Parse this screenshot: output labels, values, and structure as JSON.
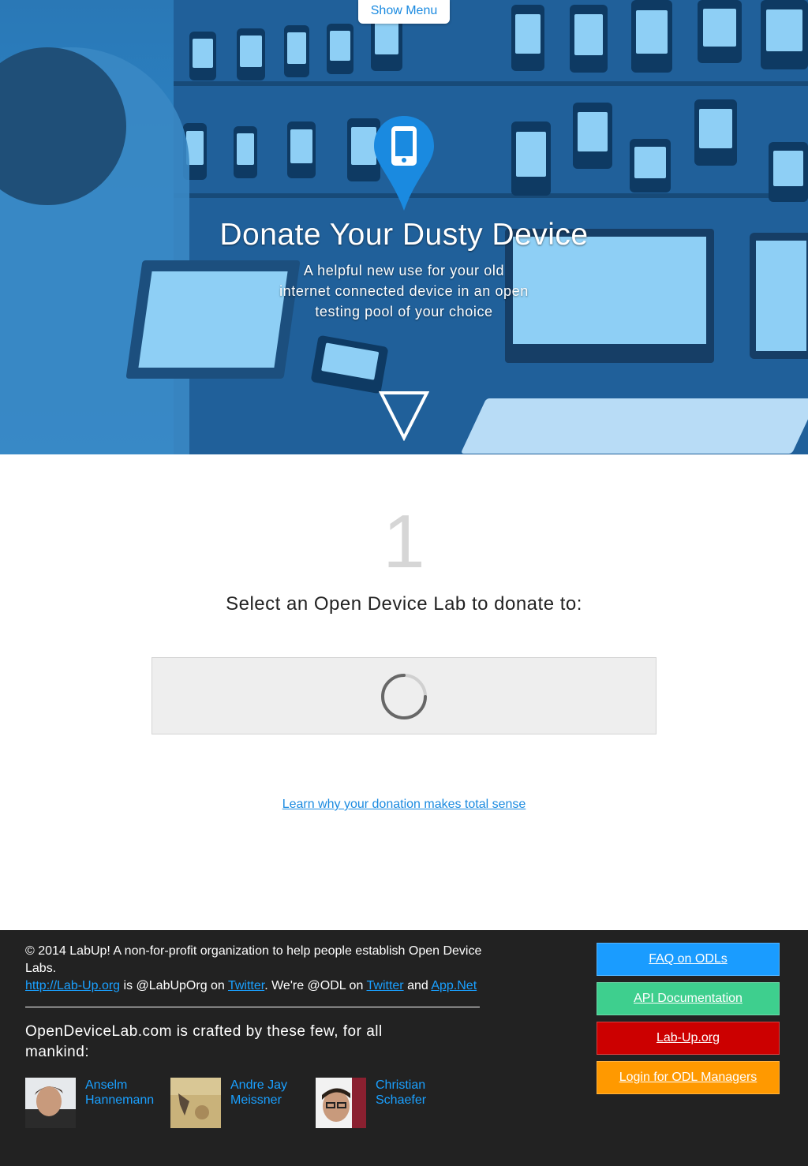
{
  "header": {
    "menu_button": "Show Menu"
  },
  "hero": {
    "title": "Donate Your Dusty Device",
    "subtitle": "A helpful new use for your old internet connected device in an open testing pool of your choice",
    "accent_color": "#1a8ae0"
  },
  "step": {
    "number": "1",
    "label": "Select an Open Device Lab to donate to:"
  },
  "learn_link": "Learn why your donation makes total sense",
  "footer": {
    "copyright": "© 2014 LabUp! A non-for-profit organization to help people establish Open Device Labs.",
    "lab_up_url": "http://Lab-Up.org",
    "is_text": " is @LabUpOrg on ",
    "twitter_1": "Twitter",
    "were_text": ". We're @ODL on ",
    "twitter_2": "Twitter",
    "and_text": " and ",
    "appnet": "App.Net",
    "crafted_by": "OpenDeviceLab.com is crafted by these few, for all mankind:",
    "people": [
      {
        "name": "Anselm Hannemann"
      },
      {
        "name": "Andre Jay Meissner"
      },
      {
        "name": "Christian Schaefer"
      }
    ],
    "buttons": [
      {
        "label": "FAQ on ODLs",
        "color": "#1a9cff"
      },
      {
        "label": "API Documentation",
        "color": "#3ecf8e"
      },
      {
        "label": "Lab-Up.org",
        "color": "#cc0000"
      },
      {
        "label": "Login for ODL Managers",
        "color": "#ff9900"
      }
    ]
  }
}
